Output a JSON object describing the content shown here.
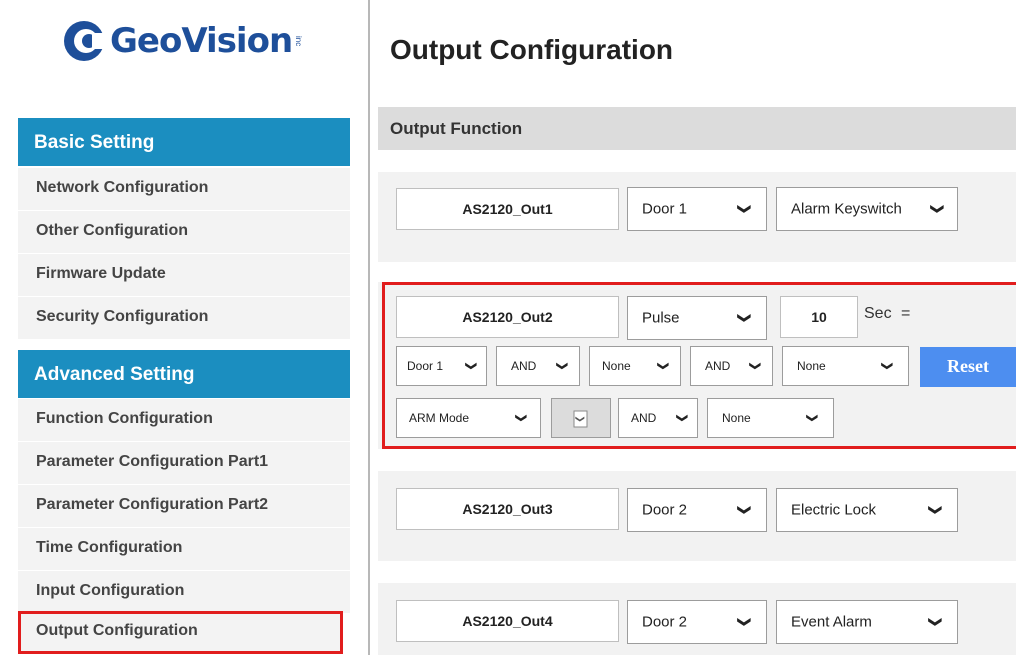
{
  "brand": {
    "name": "GeoVision",
    "suffix": "inc"
  },
  "sidebar": {
    "basic_header": "Basic Setting",
    "basic_items": [
      "Network Configuration",
      "Other Configuration",
      "Firmware Update",
      "Security Configuration"
    ],
    "advanced_header": "Advanced Setting",
    "advanced_items": [
      "Function Configuration",
      "Parameter Configuration Part1",
      "Parameter Configuration Part2",
      "Time Configuration",
      "Input Configuration",
      "Output Configuration"
    ]
  },
  "main": {
    "title": "Output Configuration",
    "section": "Output Function",
    "out1": {
      "name": "AS2120_Out1",
      "door": "Door 1",
      "type": "Alarm Keyswitch"
    },
    "out2": {
      "name": "AS2120_Out2",
      "mode": "Pulse",
      "seconds": "10",
      "sec_label": "Sec",
      "eq": "=",
      "row2": [
        "Door 1",
        "AND",
        "None",
        "AND",
        "None"
      ],
      "reset_label": "Reset",
      "row3_mode": "ARM Mode",
      "row3_logic": "AND",
      "row3_value": "None"
    },
    "out3": {
      "name": "AS2120_Out3",
      "door": "Door 2",
      "type": "Electric Lock"
    },
    "out4": {
      "name": "AS2120_Out4",
      "door": "Door 2",
      "type": "Event Alarm"
    }
  },
  "icons": {
    "dropdown": "chevron-down-icon",
    "logo": "geovision-logo-icon"
  },
  "colors": {
    "header_blue": "#1b8ec0",
    "highlight_red": "#e11d1d",
    "reset_blue": "#4d8ef0",
    "brand_blue": "#1e4f9a"
  }
}
